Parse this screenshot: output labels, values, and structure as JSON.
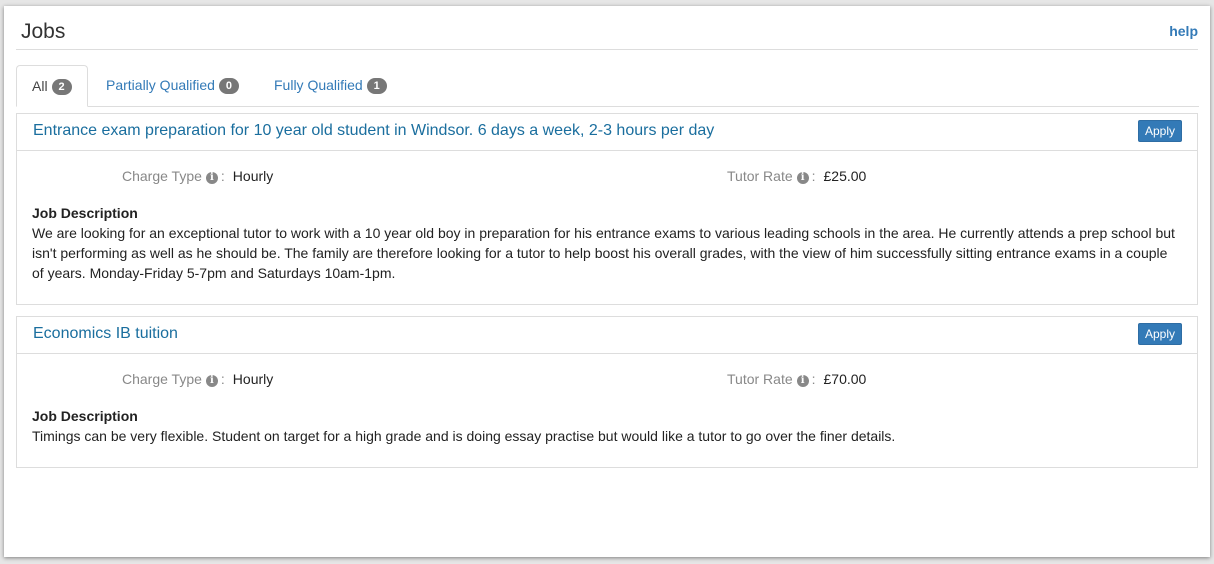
{
  "header": {
    "title": "Jobs",
    "help_label": "help"
  },
  "tabs": [
    {
      "label": "All",
      "count": "2",
      "active": true
    },
    {
      "label": "Partially Qualified",
      "count": "0",
      "active": false
    },
    {
      "label": "Fully Qualified",
      "count": "1",
      "active": false
    }
  ],
  "jobs": [
    {
      "title": "Entrance exam preparation for 10 year old student in Windsor. 6 days a week, 2-3 hours per day",
      "apply_label": "Apply",
      "charge_type_label": "Charge Type",
      "charge_type_value": "Hourly",
      "rate_label": "Tutor Rate",
      "rate_value": "£25.00",
      "description_heading": "Job Description",
      "description": "We are looking for an exceptional tutor to work with a 10 year old boy in preparation for his entrance exams to various leading schools in the area. He currently attends a prep school but isn't performing as well as he should be. The family are therefore looking for a tutor to help boost his overall grades, with the view of him successfully sitting entrance exams in a couple of years. Monday-Friday 5-7pm and Saturdays 10am-1pm."
    },
    {
      "title": "Economics IB tuition",
      "apply_label": "Apply",
      "charge_type_label": "Charge Type",
      "charge_type_value": "Hourly",
      "rate_label": "Tutor Rate",
      "rate_value": "£70.00",
      "description_heading": "Job Description",
      "description": "Timings can be very flexible. Student on target for a high grade and is doing essay practise but would like a tutor to go over the finer details."
    }
  ],
  "icons": {
    "info": "info-icon"
  },
  "colors": {
    "link": "#337ab7",
    "apply_button": "#337ab7",
    "badge": "#777777"
  }
}
